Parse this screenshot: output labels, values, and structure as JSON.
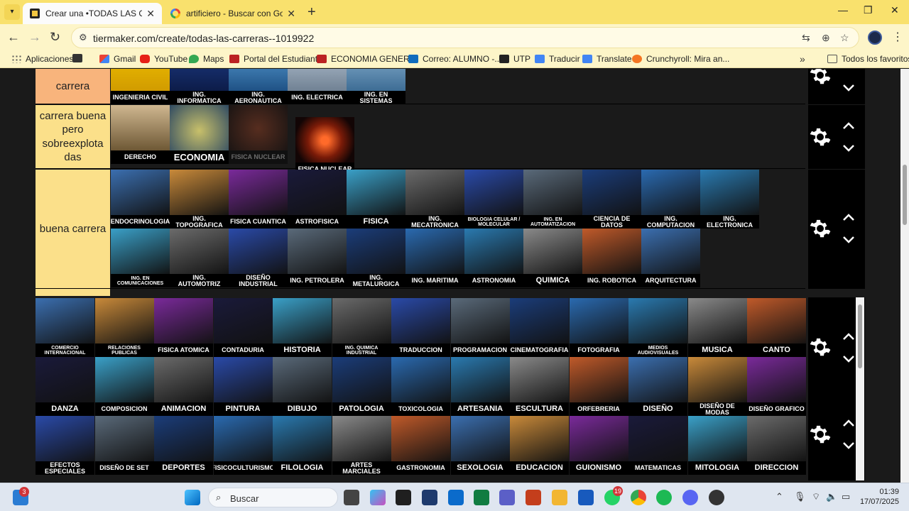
{
  "browser": {
    "tabs": [
      {
        "title": "Crear una •TODAS LAS CARRERAS",
        "active": true
      },
      {
        "title": "artificiero - Buscar con Google",
        "active": false
      }
    ],
    "url": "tiermaker.com/create/todas-las-carreras--1019922",
    "bookmarks": [
      "Aplicaciones",
      "Gmail",
      "YouTube",
      "Maps",
      "Portal del Estudiante",
      "ECONOMIA GENER...",
      "Correo: ALUMNO -...",
      "UTP",
      "Traducir",
      "Translate",
      "Crunchyroll: Mira an...",
      "Todos los favoritos"
    ]
  },
  "tiers": [
    {
      "label": "carrera",
      "color": "#f8b47c",
      "items": [
        "INGENIERIA CIVIL",
        "ING. INFORMATICA",
        "ING. AERONAUTICA",
        "ING. ELECTRICA",
        "ING. EN SISTEMAS"
      ]
    },
    {
      "label": "carrera buena pero sobreexplota das",
      "color": "#fbe08a",
      "items": [
        "DERECHO",
        "ECONOMIA",
        "FISICA NUCLEAR",
        "FISICA NUCLEAR"
      ]
    },
    {
      "label": "buena carrera",
      "color": "#fbe08a",
      "items_row1": [
        "ENDOCRINOLOGIA",
        "ING. TOPOGRAFICA",
        "FISICA CUANTICA",
        "ASTROFISICA",
        "FISICA",
        "ING. MECATRONICA",
        "BIOLOGIA CELULAR / MOLECULAR",
        "ING. EN AUTOMATIZACION",
        "CIENCIA DE DATOS",
        "ING. COMPUTACION",
        "ING. ELECTRONICA"
      ],
      "items_row2": [
        "ING. EN COMUNICACIONES",
        "ING. AUTOMOTRIZ",
        "DISEÑO INDUSTRIAL",
        "ING. PETROLERA",
        "ING. METALURGICA",
        "ING. MARITIMA",
        "ASTRONOMIA",
        "QUIMICA",
        "ING. ROBOTICA",
        "ARQUITECTURA"
      ]
    }
  ],
  "pool": {
    "row1": [
      "COMERCIO INTERNACIONAL",
      "RELACIONES PUBLICAS",
      "FISICA ATOMICA",
      "CONTADURIA",
      "HISTORIA",
      "ING. QUIMICA INDUSTRIAL",
      "TRADUCCION",
      "PROGRAMACION",
      "CINEMATOGRAFIA",
      "FOTOGRAFIA",
      "MEDIOS AUDIOVISUALES",
      "MUSICA",
      "CANTO"
    ],
    "row2": [
      "DANZA",
      "COMPOSICION",
      "ANIMACION",
      "PINTURA",
      "DIBUJO",
      "PATOLOGIA",
      "TOXICOLOGIA",
      "ARTESANIA",
      "ESCULTURA",
      "ORFEBRERIA",
      "DISEÑO",
      "DISEÑO DE MODAS",
      "DISEÑO GRAFICO"
    ],
    "row3": [
      "EFECTOS ESPECIALES",
      "DISEÑO DE SET",
      "DEPORTES",
      "FISICOCULTURISMO",
      "FILOLOGIA",
      "ARTES MARCIALES",
      "GASTRONOMIA",
      "SEXOLOGIA",
      "EDUCACION",
      "GUIONISMO",
      "MATEMATICAS",
      "MITOLOGIA",
      "DIRECCION"
    ]
  },
  "taskbar": {
    "search_placeholder": "Buscar",
    "time": "01:39",
    "date": "17/07/2025",
    "widget_badge": "3",
    "whatsapp_badge": "19"
  }
}
